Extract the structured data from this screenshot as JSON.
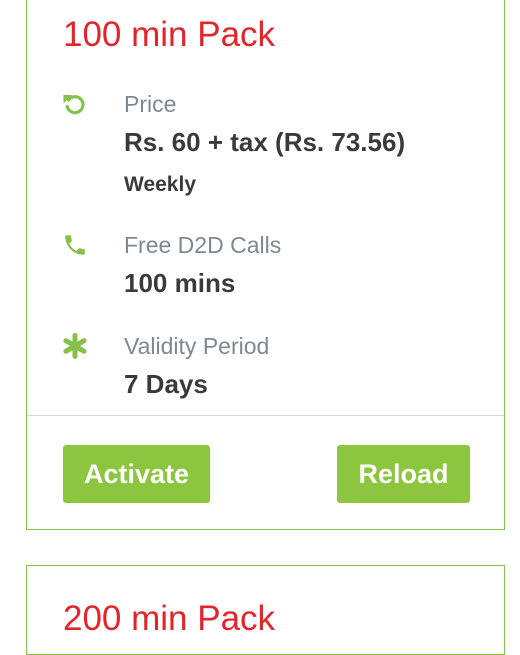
{
  "packs": [
    {
      "title": "100 min Pack",
      "price": {
        "label": "Price",
        "value": "Rs. 60 + tax (Rs. 73.56)",
        "period": "Weekly",
        "icon": "refresh-icon"
      },
      "calls": {
        "label": "Free D2D Calls",
        "value": "100 mins",
        "icon": "phone-icon"
      },
      "validity": {
        "label": "Validity Period",
        "value": "7 Days",
        "icon": "asterisk-icon"
      },
      "actions": {
        "activate_label": "Activate",
        "reload_label": "Reload"
      }
    },
    {
      "title": "200 min Pack"
    }
  ],
  "colors": {
    "title": "#e3242b",
    "accent": "#8cc63f",
    "icon": "#86c14a",
    "label": "#7d8991",
    "value": "#3a3a3a"
  }
}
